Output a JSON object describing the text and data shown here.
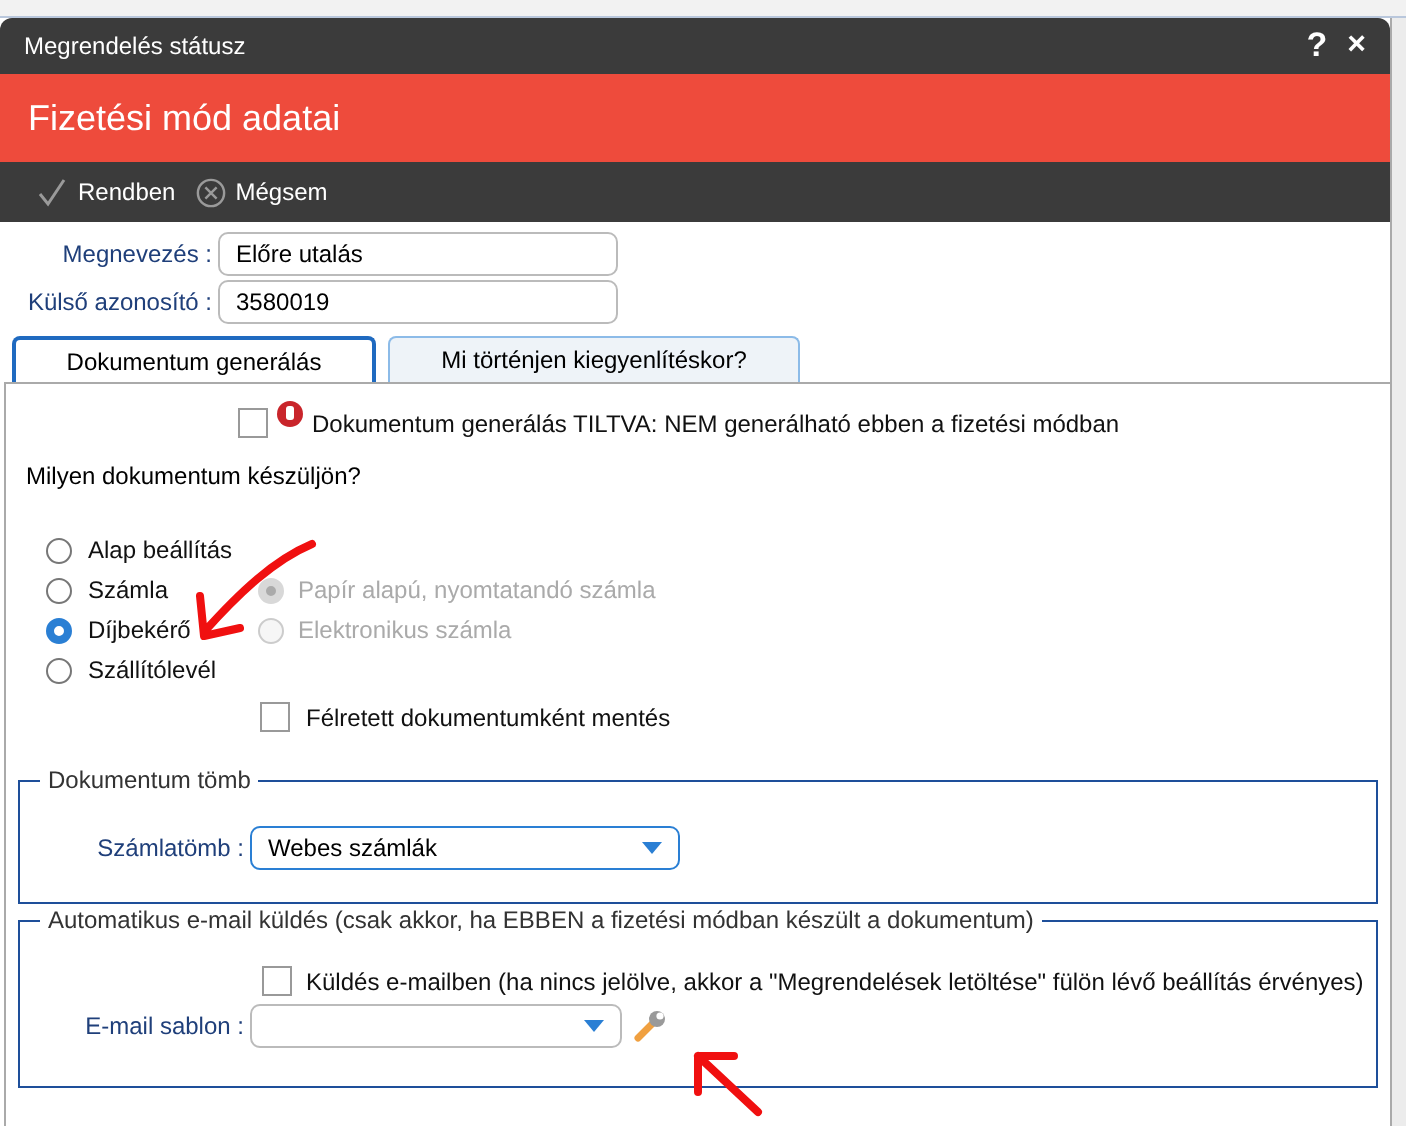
{
  "window": {
    "title": "Megrendelés státusz",
    "help": "?",
    "close": "×"
  },
  "header": {
    "title": "Fizetési mód adatai"
  },
  "toolbar": [
    {
      "label": "Rendben",
      "kind": "ok"
    },
    {
      "label": "Mégsem",
      "kind": "cancel"
    }
  ],
  "fields": [
    {
      "label": "Megnevezés :",
      "value": "Előre utalás"
    },
    {
      "label": "Külső azonosító :",
      "value": "3580019"
    }
  ],
  "tabs": [
    {
      "label": "Dokumentum generálás",
      "selected": true
    },
    {
      "label": "Mi történjen kiegyenlítéskor?",
      "selected": false
    }
  ],
  "disable_option": {
    "label": "Dokumentum generálás TILTVA: NEM generálható ebben a fizetési módban",
    "checked": false
  },
  "question": "Milyen dokumentum készüljön?",
  "document_types": [
    {
      "label": "Alap beállítás",
      "selected": false
    },
    {
      "label": "Számla",
      "selected": false
    },
    {
      "label": "Díjbekérő",
      "selected": true
    },
    {
      "label": "Szállítólevél",
      "selected": false
    }
  ],
  "invoice_types": [
    {
      "label": "Papír alapú, nyomtatandó számla",
      "selected": true,
      "disabled": true
    },
    {
      "label": "Elektronikus számla",
      "selected": false,
      "disabled": true
    }
  ],
  "draft_option": {
    "label": "Félretett dokumentumként mentés",
    "checked": false
  },
  "block_section": {
    "legend": "Dokumentum tömb",
    "label": "Számlatömb :",
    "value": "Webes számlák"
  },
  "email_section": {
    "legend": "Automatikus e-mail küldés (csak akkor, ha EBBEN a fizetési módban készült a dokumentum)",
    "send": {
      "label": "Küldés e-mailben (ha nincs jelölve, akkor a \"Megrendelések letöltése\" fülön lévő beállítás érvényes)",
      "checked": false
    },
    "template_label": "E-mail sablon :"
  }
}
